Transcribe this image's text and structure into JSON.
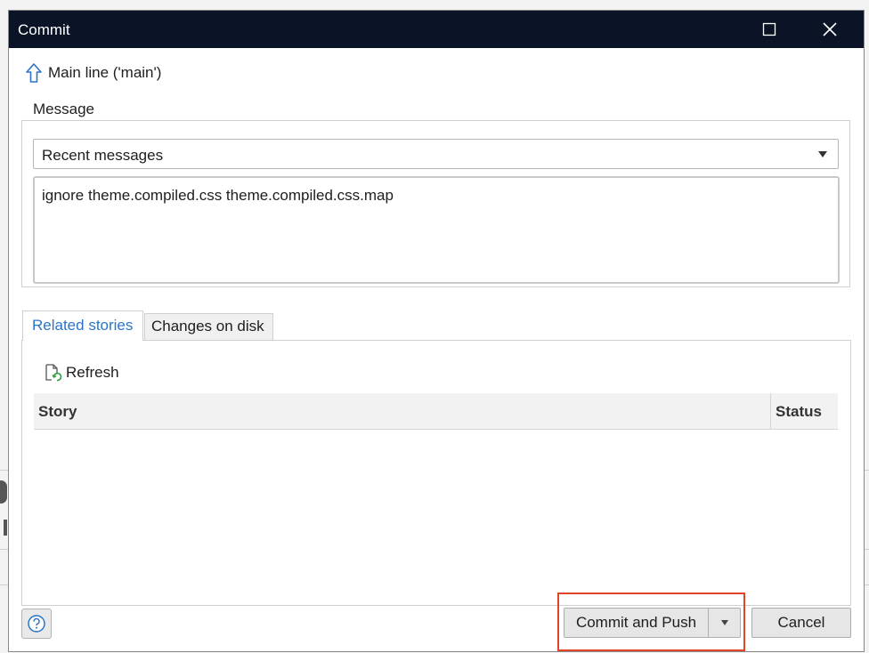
{
  "window": {
    "title": "Commit",
    "maximize_icon": "maximize-icon",
    "close_icon": "close-icon"
  },
  "branch": {
    "icon": "arrow-up-icon",
    "label": "Main line ('main')"
  },
  "message": {
    "legend": "Message",
    "recent_select": "Recent messages",
    "text": "ignore theme.compiled.css theme.compiled.css.map"
  },
  "tabs": [
    {
      "label": "Related stories",
      "active": true
    },
    {
      "label": "Changes on disk",
      "active": false
    }
  ],
  "related_stories": {
    "refresh_label": "Refresh",
    "refresh_icon": "refresh-icon",
    "columns": [
      "Story",
      "Status"
    ],
    "rows": []
  },
  "footer": {
    "help_icon": "help-icon",
    "commit_push_label": "Commit and Push",
    "cancel_label": "Cancel"
  },
  "colors": {
    "titlebar": "#0b1326",
    "active_tab": "#2b74c7",
    "highlight": "#e0452a"
  }
}
